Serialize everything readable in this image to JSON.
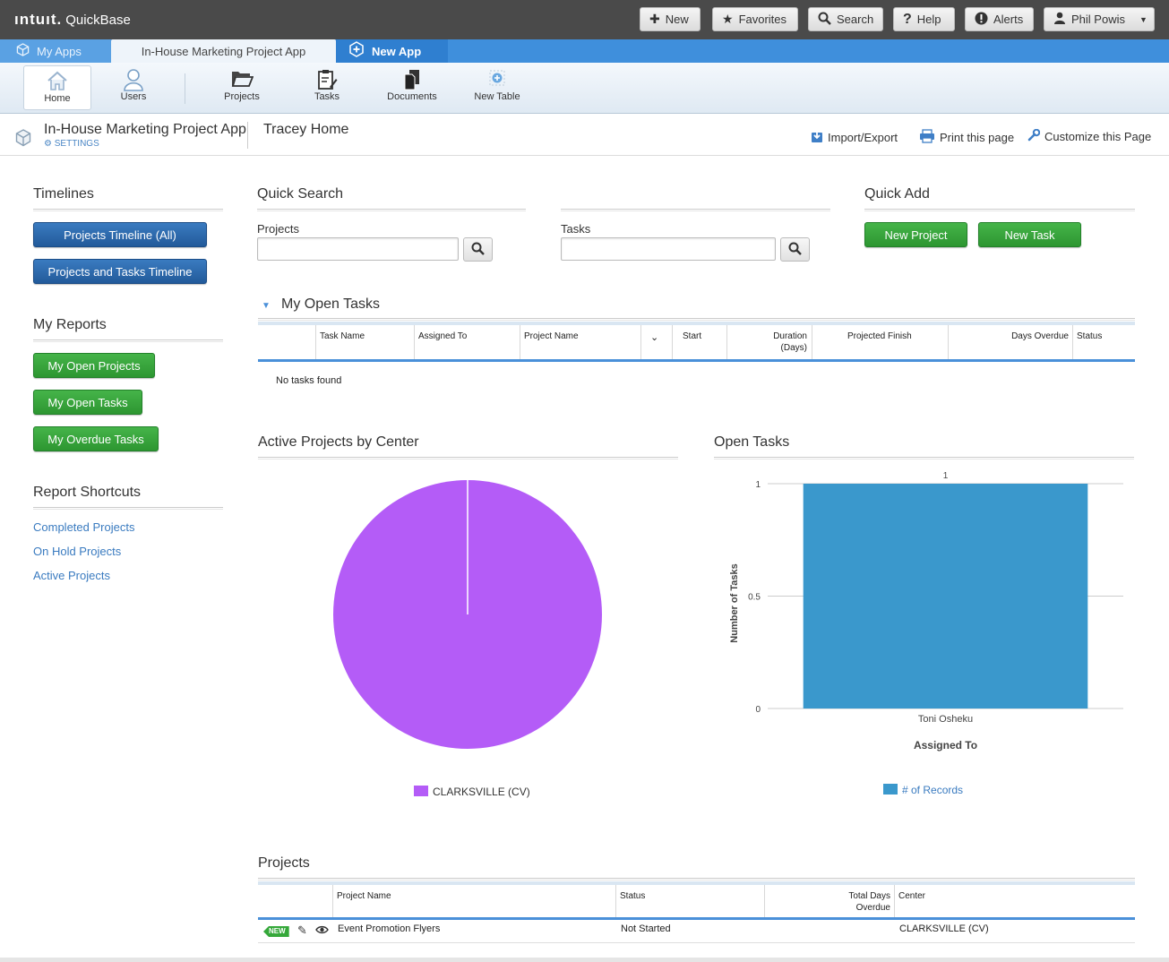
{
  "brand": {
    "intuit": "ıntuıt.",
    "product": "QuickBase"
  },
  "topnav": {
    "new": "New",
    "favorites": "Favorites",
    "search": "Search",
    "help": "Help",
    "alerts": "Alerts",
    "user": "Phil Powis"
  },
  "apptabs": {
    "my_apps": "My Apps",
    "current": "In-House Marketing Project App",
    "new_app": "New App"
  },
  "toolbar": {
    "home": "Home",
    "users": "Users",
    "projects": "Projects",
    "tasks": "Tasks",
    "documents": "Documents",
    "new_table": "New Table"
  },
  "breadcrumb": {
    "app": "In-House Marketing Project App",
    "settings": "SETTINGS",
    "page": "Tracey Home"
  },
  "page_actions": {
    "import_export": "Import/Export",
    "print": "Print this page",
    "customize": "Customize this Page"
  },
  "timelines": {
    "title": "Timelines",
    "buttons": [
      "Projects Timeline (All)",
      "Projects and Tasks Timeline"
    ]
  },
  "my_reports": {
    "title": "My Reports",
    "buttons": [
      "My Open Projects",
      "My Open Tasks",
      "My Overdue Tasks"
    ]
  },
  "report_shortcuts": {
    "title": "Report Shortcuts",
    "links": [
      "Completed Projects",
      "On Hold Projects",
      "Active Projects"
    ]
  },
  "quick_search": {
    "title": "Quick Search",
    "projects_label": "Projects",
    "tasks_label": "Tasks",
    "projects_value": "",
    "tasks_value": ""
  },
  "quick_add": {
    "title": "Quick Add",
    "new_project": "New Project",
    "new_task": "New Task"
  },
  "open_tasks_table": {
    "title": "My Open Tasks",
    "columns": [
      "Task Name",
      "Assigned To",
      "Project Name",
      "Start",
      "Duration\n(Days)",
      "Projected Finish",
      "Days Overdue",
      "Status"
    ],
    "empty": "No tasks found"
  },
  "colors": {
    "pie": "#b45cf7",
    "bar": "#3a98cc",
    "link": "#3a7bc0",
    "green": "#2d9631",
    "blue": "#225a9a"
  },
  "chart_data": [
    {
      "type": "pie",
      "title": "Active Projects by Center",
      "categories": [
        "CLARKSVILLE (CV)"
      ],
      "values": [
        1
      ],
      "legend": "bottom"
    },
    {
      "type": "bar",
      "title": "Open Tasks",
      "categories": [
        "Toni Osheku"
      ],
      "series": [
        {
          "name": "# of Records",
          "values": [
            1
          ]
        }
      ],
      "xlabel": "Assigned To",
      "ylabel": "Number of Tasks",
      "ylim": [
        0,
        1
      ],
      "yticks": [
        "0",
        "0.5",
        "1"
      ],
      "data_label": "1",
      "grid": true,
      "legend": "bottom"
    }
  ],
  "projects_table": {
    "title": "Projects",
    "columns": [
      "Project Name",
      "Status",
      "Total Days\nOverdue",
      "Center"
    ],
    "rows": [
      {
        "badge": "NEW",
        "name": "Event Promotion Flyers",
        "status": "Not Started",
        "overdue": "",
        "center": "CLARKSVILLE (CV)"
      }
    ]
  }
}
